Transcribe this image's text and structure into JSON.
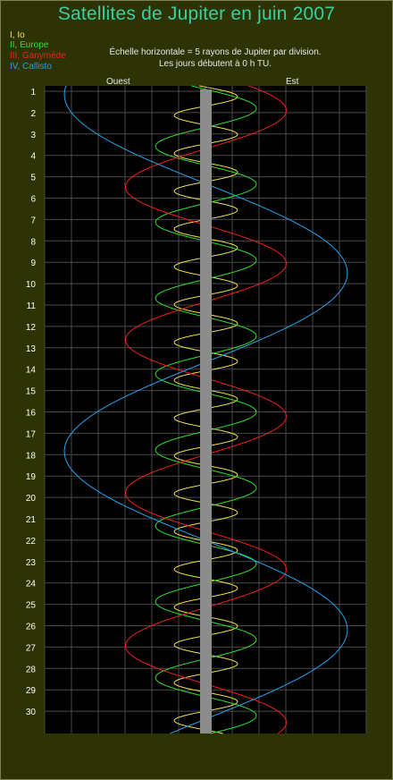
{
  "title": "Satellites de Jupiter en juin 2007",
  "legend": [
    {
      "label": "I, Io",
      "color": "#f2e24a"
    },
    {
      "label": "II, Europe",
      "color": "#2ee02e"
    },
    {
      "label": "III, Ganymède",
      "color": "#ee2020"
    },
    {
      "label": "IV, Callisto",
      "color": "#22a4ee"
    }
  ],
  "notes": {
    "scale": "Échelle horizontale = 5 rayons de Jupiter par division.",
    "time": "Les jours débutent à 0 h TU."
  },
  "directions": {
    "west": "Ouest",
    "east": "Est"
  },
  "chart_data": {
    "type": "line",
    "title": "Satellites de Jupiter en juin 2007",
    "xlabel": "",
    "ylabel": "",
    "y_ticks": [
      1,
      2,
      3,
      4,
      5,
      6,
      7,
      8,
      9,
      10,
      11,
      12,
      13,
      14,
      15,
      16,
      17,
      18,
      19,
      20,
      21,
      22,
      23,
      24,
      25,
      26,
      27,
      28,
      29,
      30
    ],
    "x_unit_per_division": 5,
    "x_range_jupiter_radii": [
      -30,
      30
    ],
    "grid": true,
    "series": [
      {
        "name": "I, Io",
        "color": "#f2e24a",
        "amplitude": 5.9,
        "period_days": 1.769,
        "phase_day": 1.25
      },
      {
        "name": "II, Europe",
        "color": "#2ee02e",
        "amplitude": 9.4,
        "period_days": 3.551,
        "phase_day": 1.8
      },
      {
        "name": "III, Ganymède",
        "color": "#ee2020",
        "amplitude": 15.0,
        "period_days": 7.155,
        "phase_day": 1.9
      },
      {
        "name": "IV, Callisto",
        "color": "#22a4ee",
        "amplitude": 26.4,
        "period_days": 16.69,
        "phase_day": 9.5
      }
    ]
  }
}
